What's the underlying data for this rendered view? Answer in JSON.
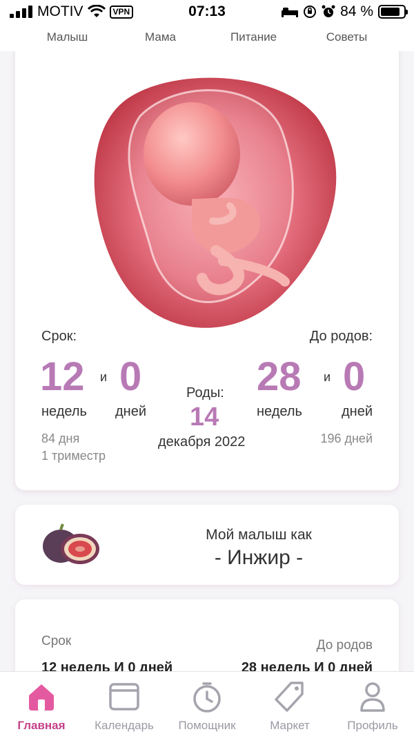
{
  "status_bar": {
    "carrier": "MOTIV",
    "vpn": "VPN",
    "time": "07:13",
    "battery": "84 %",
    "battery_level": 0.84
  },
  "tabs": [
    "Малыш",
    "Мама",
    "Питание",
    "Советы"
  ],
  "summary": {
    "term_label": "Срок:",
    "to_birth_label": "До родов:",
    "term_weeks": "12",
    "term_days": "0",
    "and": "и",
    "weeks_word": "недель",
    "days_word": "дней",
    "term_total_days": "84 дня",
    "trimester": "1 триместр",
    "birth_label": "Роды:",
    "birth_day": "14",
    "birth_month_year": "декабря 2022",
    "left_weeks": "28",
    "left_days": "0",
    "left_total_days": "196 дней"
  },
  "fruit": {
    "caption": "Мой малыш как",
    "name": "- Инжир -"
  },
  "info": {
    "term_label": "Срок",
    "to_birth_label": "До родов",
    "term_value": "12 недель И 0 дней",
    "left_value": "28 недель И 0 дней"
  },
  "bottom_nav": [
    {
      "label": "Главная",
      "icon": "home-icon",
      "active": true
    },
    {
      "label": "Календарь",
      "icon": "calendar-icon",
      "active": false
    },
    {
      "label": "Помощник",
      "icon": "stopwatch-icon",
      "active": false
    },
    {
      "label": "Маркет",
      "icon": "tag-icon",
      "active": false
    },
    {
      "label": "Профиль",
      "icon": "profile-icon",
      "active": false
    }
  ],
  "colors": {
    "accent": "#b87ab5",
    "active_nav": "#c4418a",
    "inactive_nav": "#9a9aa4"
  }
}
